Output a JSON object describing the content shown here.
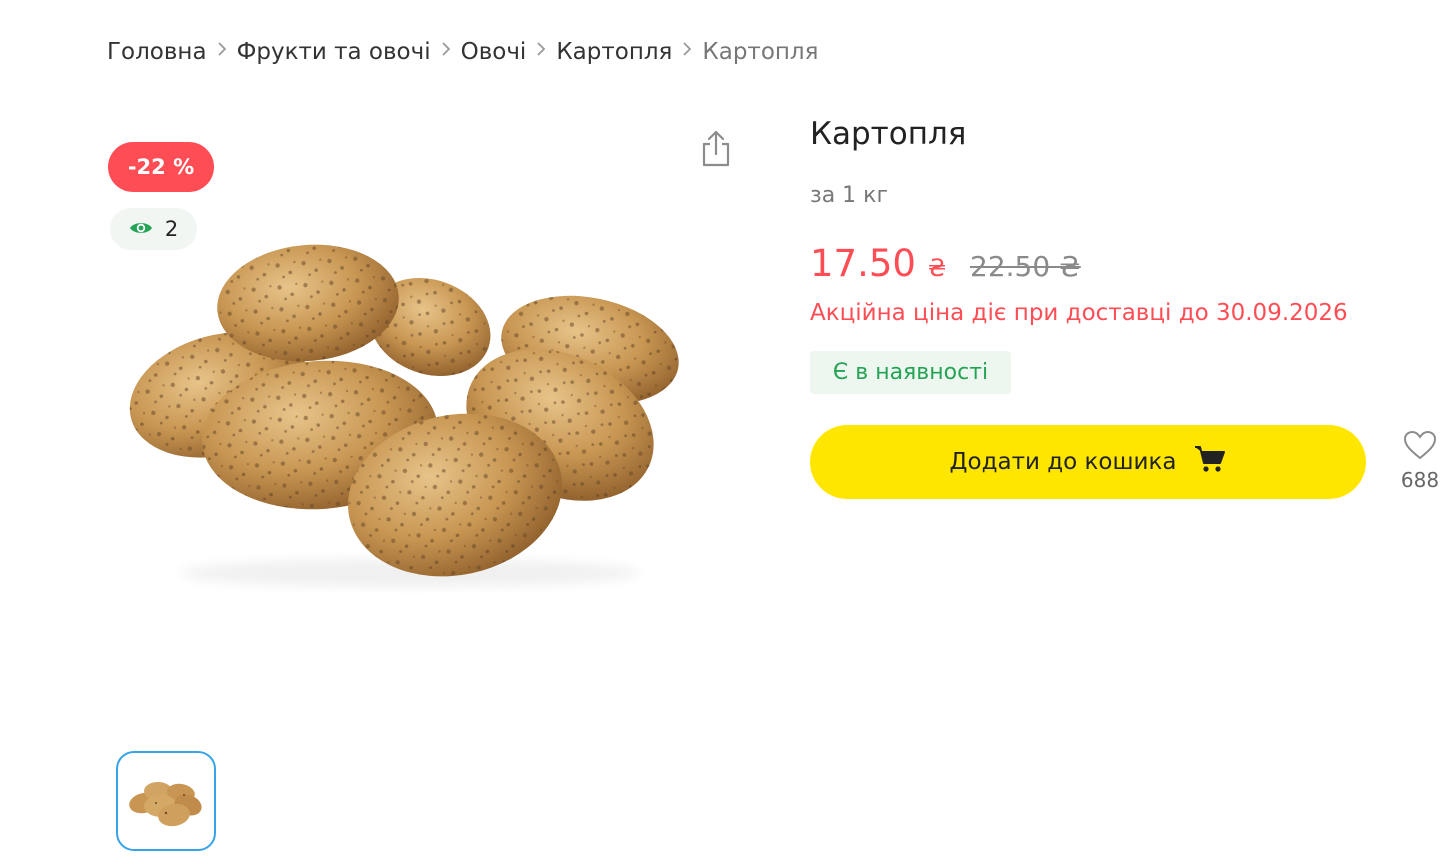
{
  "breadcrumb": {
    "items": [
      "Головна",
      "Фрукти та овочі",
      "Овочі",
      "Картопля"
    ],
    "current": "Картопля"
  },
  "gallery": {
    "discount_badge": "-22 %",
    "views_count": "2",
    "image_alt_icon": "potatoes-image",
    "share_icon": "share-icon",
    "thumbnail_icon": "potatoes-thumbnail"
  },
  "product": {
    "title": "Картопля",
    "unit": "за 1 кг",
    "price": "17.50",
    "currency": "₴",
    "old_price": "22.50 ₴",
    "promo_note": "Акційна ціна діє при доставці до 30.09.2026",
    "stock_status": "Є в наявності",
    "add_to_cart_label": "Додати до кошика",
    "favorites_count": "688"
  },
  "colors": {
    "accent_red": "#ff4d55",
    "cart_yellow": "#ffe600",
    "stock_green": "#25a456",
    "thumb_border": "#38a3e8"
  }
}
